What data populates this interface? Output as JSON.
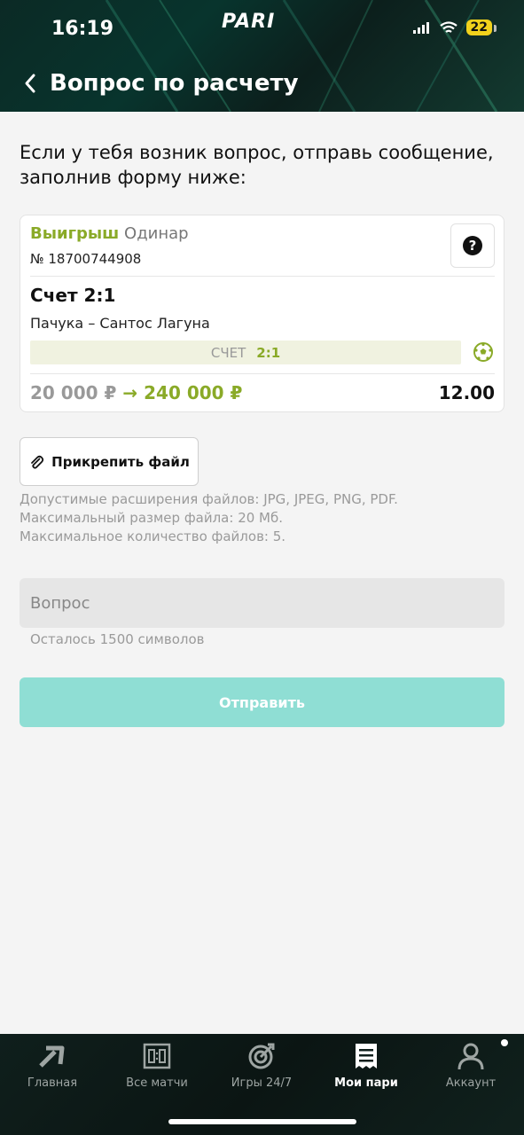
{
  "status_bar": {
    "time": "16:19",
    "battery": "22"
  },
  "brand": {
    "logo": "PARI"
  },
  "header": {
    "title": "Вопрос по расчету",
    "back_icon": "chevron-left-icon"
  },
  "intro": {
    "text": "Если у тебя возник вопрос, отправь сообщение, заполнив форму ниже:"
  },
  "bet": {
    "status": "Выигрыш",
    "type": "Одинар",
    "number": "№ 18700744908",
    "market": "Счет 2:1",
    "event": "Пачука – Сантос Лагуна",
    "score_label": "СЧЕТ",
    "score_value": "2:1",
    "stake": "20 000 ₽",
    "arrow": "→",
    "payout": "240 000 ₽",
    "odds": "12.00",
    "help_icon": "question-circle-icon",
    "sport_icon": "soccer-ball-icon"
  },
  "attach": {
    "label": "Прикрепить файл",
    "icon": "paperclip-icon"
  },
  "rules": {
    "line1_prefix": "Допустимые расширения файлов: ",
    "line1_value": "JPG, JPEG, PNG, PDF.",
    "line2_prefix": "Максимальный размер файла: ",
    "line2_value": "20 Мб.",
    "line3_prefix": "Максимальное количество файлов: ",
    "line3_value": "5."
  },
  "question": {
    "placeholder": "Вопрос",
    "value": "",
    "counter": "Осталось 1500 символов"
  },
  "submit": {
    "label": "Отправить"
  },
  "colors": {
    "accent_green": "#8aaa28",
    "submit_teal": "#8fded4",
    "header_dark": "#0b2a25"
  },
  "nav": {
    "items": [
      {
        "label": "Главная",
        "icon": "home-arrow-icon"
      },
      {
        "label": "Все матчи",
        "icon": "scoreboard-icon"
      },
      {
        "label": "Игры 24/7",
        "icon": "target-icon"
      },
      {
        "label": "Мои пари",
        "icon": "receipt-icon"
      },
      {
        "label": "Аккаунт",
        "icon": "user-icon"
      }
    ],
    "active": "Мои пари"
  }
}
